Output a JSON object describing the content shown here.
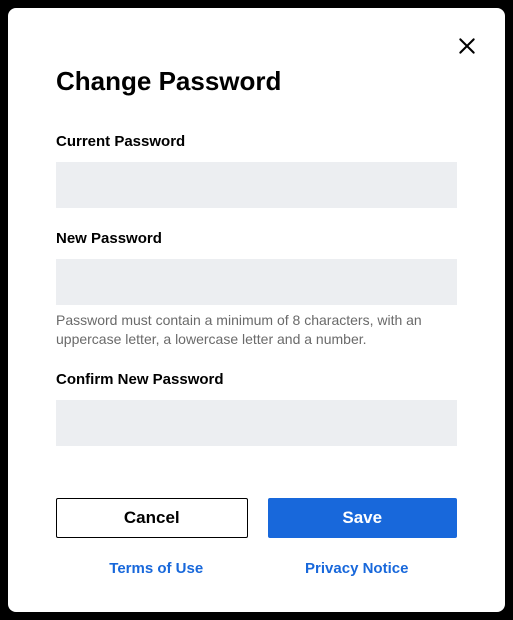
{
  "modal": {
    "title": "Change Password",
    "fields": {
      "current": {
        "label": "Current Password",
        "value": ""
      },
      "new": {
        "label": "New Password",
        "value": "",
        "hint": "Password must contain a minimum of 8 characters, with an uppercase letter, a lowercase letter and a number."
      },
      "confirm": {
        "label": "Confirm New Password",
        "value": ""
      }
    },
    "buttons": {
      "cancel": "Cancel",
      "save": "Save"
    },
    "links": {
      "terms": "Terms of Use",
      "privacy": "Privacy Notice"
    }
  },
  "colors": {
    "accent": "#1868db",
    "input_bg": "#eceef1"
  }
}
